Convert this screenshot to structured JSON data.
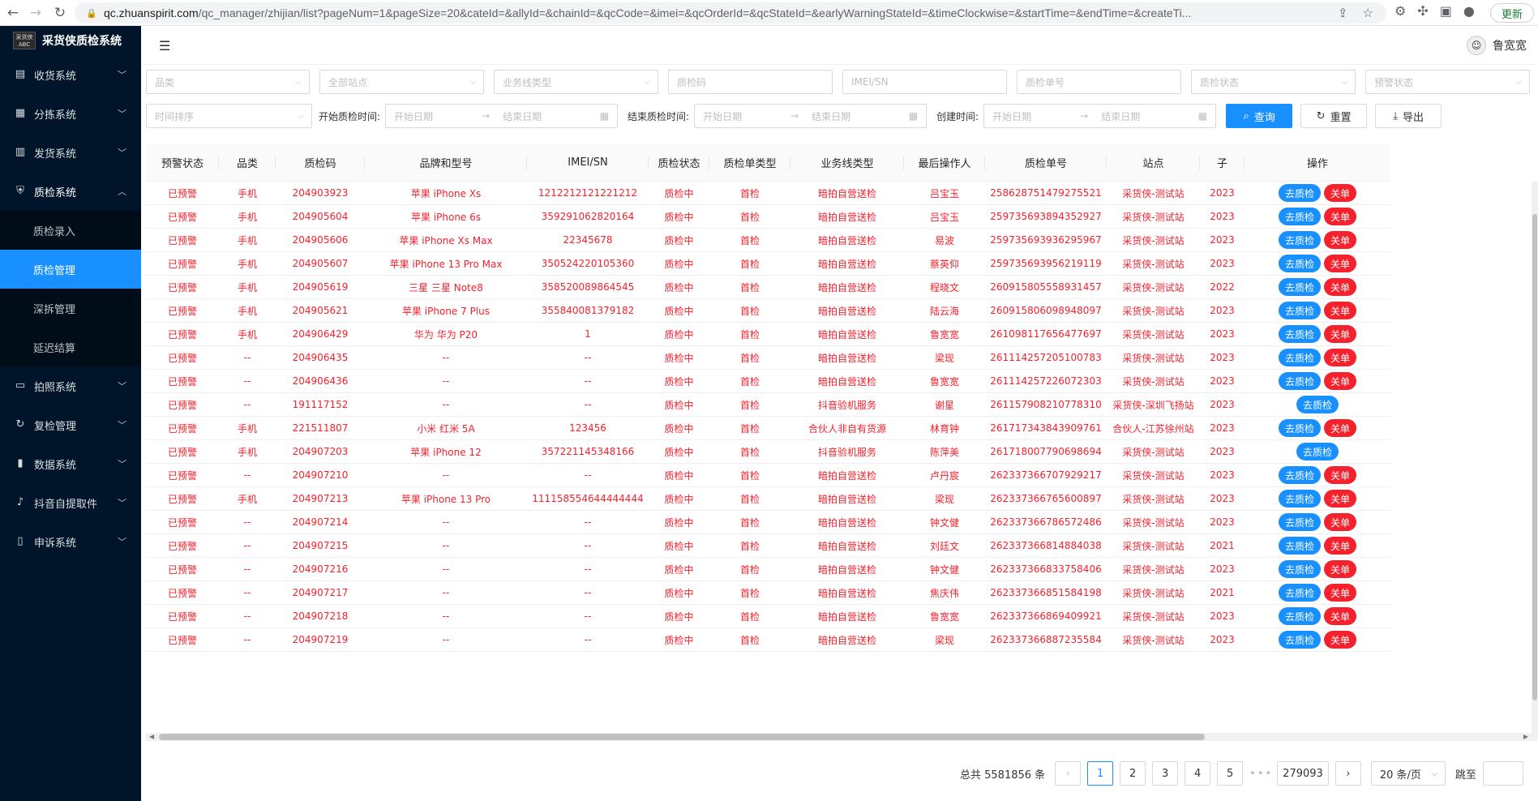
{
  "browser": {
    "host": "qc.zhuanspirit.com",
    "path": "/qc_manager/zhijian/list?pageNum=1&pageSize=20&cateId=&allyId=&chainId=&qcCode=&imei=&qcOrderId=&qcStateId=&earlyWarningStateId=&timeClockwise=&startTime=&endTime=&createTi...",
    "update_label": "更新"
  },
  "brand": {
    "title": "采货侠质检系统",
    "logo_text": "采货侠 ABC"
  },
  "sidebar": {
    "items": [
      {
        "label": "收货系统",
        "icon": "inbox-icon"
      },
      {
        "label": "分拣系统",
        "icon": "grid-icon"
      },
      {
        "label": "发货系统",
        "icon": "send-icon"
      },
      {
        "label": "质检系统",
        "icon": "shield-icon"
      },
      {
        "label": "拍照系统",
        "icon": "camera-icon"
      },
      {
        "label": "复检管理",
        "icon": "refresh-icon"
      },
      {
        "label": "数据系统",
        "icon": "bar-chart-icon"
      },
      {
        "label": "抖音自提取件",
        "icon": "tiktok-icon"
      },
      {
        "label": "申诉系统",
        "icon": "file-icon"
      }
    ],
    "sub_items": [
      {
        "label": "质检录入"
      },
      {
        "label": "质检管理"
      },
      {
        "label": "深拆管理"
      },
      {
        "label": "延迟结算"
      }
    ]
  },
  "header": {
    "user_name": "鲁宽宽"
  },
  "filters": {
    "category": "品类",
    "station": "全部站点",
    "business_line": "业务线类型",
    "qc_code": "质检码",
    "imei": "IMEI/SN",
    "qc_order": "质检单号",
    "qc_state": "质检状态",
    "warning_state": "预警状态",
    "time_sort": "时间排序",
    "start_label": "开始质检时间:",
    "end_label": "结束质检时间:",
    "create_label": "创建时间:",
    "start_date": "开始日期",
    "end_date": "结束日期",
    "search": "查询",
    "reset": "重置",
    "export": "导出"
  },
  "table": {
    "columns": [
      "预警状态",
      "品类",
      "质检码",
      "品牌和型号",
      "IMEI/SN",
      "质检状态",
      "质检单类型",
      "业务线类型",
      "最后操作人",
      "质检单号",
      "站点",
      "子",
      "操作"
    ],
    "action_check": "去质检",
    "action_close": "关单",
    "rows": [
      [
        "已预警",
        "手机",
        "204903923",
        "苹果 iPhone Xs",
        "1212212121221212",
        "质检中",
        "首检",
        "暗拍自营送检",
        "吕宝玉",
        "258628751479275521",
        "采货侠-测试站",
        "2023",
        "both"
      ],
      [
        "已预警",
        "手机",
        "204905604",
        "苹果 iPhone 6s",
        "359291062820164",
        "质检中",
        "首检",
        "暗拍自营送检",
        "吕宝玉",
        "259735693894352927",
        "采货侠-测试站",
        "2023",
        "both"
      ],
      [
        "已预警",
        "手机",
        "204905606",
        "苹果 iPhone Xs Max",
        "22345678",
        "质检中",
        "首检",
        "暗拍自营送检",
        "易波",
        "259735693936295967",
        "采货侠-测试站",
        "2023",
        "both"
      ],
      [
        "已预警",
        "手机",
        "204905607",
        "苹果 iPhone 13 Pro Max",
        "350524220105360",
        "质检中",
        "首检",
        "暗拍自营送检",
        "蔡英仰",
        "259735693956219119",
        "采货侠-测试站",
        "2023",
        "both"
      ],
      [
        "已预警",
        "手机",
        "204905619",
        "三星 三星 Note8",
        "358520089864545",
        "质检中",
        "首检",
        "暗拍自营送检",
        "程晓文",
        "260915805558931457",
        "采货侠-测试站",
        "2022",
        "both"
      ],
      [
        "已预警",
        "手机",
        "204905621",
        "苹果 iPhone 7 Plus",
        "355840081379182",
        "质检中",
        "首检",
        "暗拍自营送检",
        "陆云海",
        "260915806098948097",
        "采货侠-测试站",
        "2023",
        "both"
      ],
      [
        "已预警",
        "手机",
        "204906429",
        "华为 华为 P20",
        "1",
        "质检中",
        "首检",
        "暗拍自营送检",
        "鲁宽宽",
        "261098117656477697",
        "采货侠-测试站",
        "2023",
        "both"
      ],
      [
        "已预警",
        "--",
        "204906435",
        "--",
        "--",
        "质检中",
        "首检",
        "暗拍自营送检",
        "梁现",
        "261114257205100783",
        "采货侠-测试站",
        "2023",
        "both"
      ],
      [
        "已预警",
        "--",
        "204906436",
        "--",
        "--",
        "质检中",
        "首检",
        "暗拍自营送检",
        "鲁宽宽",
        "261114257226072303",
        "采货侠-测试站",
        "2023",
        "both"
      ],
      [
        "已预警",
        "--",
        "191117152",
        "--",
        "--",
        "质检中",
        "首检",
        "抖音验机服务",
        "谢星",
        "261157908210778310",
        "采货侠-深圳飞扬站",
        "2023",
        "check"
      ],
      [
        "已预警",
        "手机",
        "221511807",
        "小米 红米 5A",
        "123456",
        "质检中",
        "首检",
        "合伙人非自有货源",
        "林育钟",
        "261717343843909761",
        "合伙人-江苏徐州站",
        "2023",
        "both"
      ],
      [
        "已预警",
        "手机",
        "204907203",
        "苹果 iPhone 12",
        "357221145348166",
        "质检中",
        "首检",
        "抖音验机服务",
        "陈萍美",
        "261718007790698694",
        "采货侠-测试站",
        "2023",
        "check"
      ],
      [
        "已预警",
        "--",
        "204907210",
        "--",
        "--",
        "质检中",
        "首检",
        "暗拍自营送检",
        "卢丹宸",
        "262337366707929217",
        "采货侠-测试站",
        "2023",
        "both"
      ],
      [
        "已预警",
        "手机",
        "204907213",
        "苹果 iPhone 13 Pro",
        "111158554644444444",
        "质检中",
        "首检",
        "暗拍自营送检",
        "梁现",
        "262337366765600897",
        "采货侠-测试站",
        "2023",
        "both"
      ],
      [
        "已预警",
        "--",
        "204907214",
        "--",
        "--",
        "质检中",
        "首检",
        "暗拍自营送检",
        "钟文健",
        "262337366786572486",
        "采货侠-测试站",
        "2023",
        "both"
      ],
      [
        "已预警",
        "--",
        "204907215",
        "--",
        "--",
        "质检中",
        "首检",
        "暗拍自营送检",
        "刘廷文",
        "262337366814884038",
        "采货侠-测试站",
        "2021",
        "both"
      ],
      [
        "已预警",
        "--",
        "204907216",
        "--",
        "--",
        "质检中",
        "首检",
        "暗拍自营送检",
        "钟文健",
        "262337366833758406",
        "采货侠-测试站",
        "2023",
        "both"
      ],
      [
        "已预警",
        "--",
        "204907217",
        "--",
        "--",
        "质检中",
        "首检",
        "暗拍自营送检",
        "焦庆伟",
        "262337366851584198",
        "采货侠-测试站",
        "2021",
        "both"
      ],
      [
        "已预警",
        "--",
        "204907218",
        "--",
        "--",
        "质检中",
        "首检",
        "暗拍自营送检",
        "鲁宽宽",
        "262337366869409921",
        "采货侠-测试站",
        "2023",
        "both"
      ],
      [
        "已预警",
        "--",
        "204907219",
        "--",
        "--",
        "质检中",
        "首检",
        "暗拍自营送检",
        "梁现",
        "262337366887235584",
        "采货侠-测试站",
        "2023",
        "both"
      ]
    ]
  },
  "pagination": {
    "total": "总共 5581856 条",
    "pages": [
      "1",
      "2",
      "3",
      "4",
      "5"
    ],
    "last_page": "279093",
    "page_size": "20 条/页",
    "jump_label": "跳至",
    "prev": "‹",
    "next": "›",
    "ellipsis": "•••"
  },
  "colors": {
    "primary": "#1890ff",
    "danger": "#f5222d",
    "sidebar_bg": "#001529"
  }
}
